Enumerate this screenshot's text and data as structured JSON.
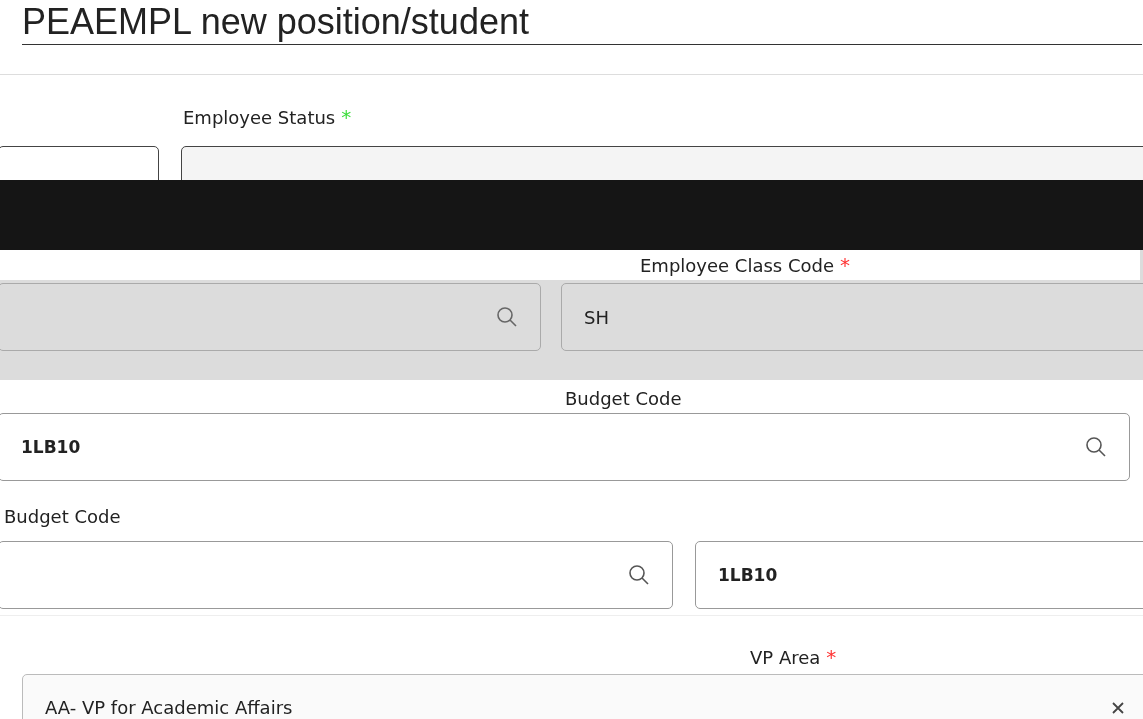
{
  "title": "PEAEMPL new position/student",
  "fields": [
    {
      "label": "Employee Status",
      "marker": "*",
      "color": "#3ddc3d"
    },
    {
      "label": "Employee Class Code",
      "marker": "*",
      "color": "#ff3333",
      "value": "SH"
    },
    {
      "label": "Budget Code",
      "value": "1LB10"
    },
    {
      "label": "Budget Code",
      "value": "1LB10"
    },
    {
      "label": "VP Area",
      "marker": "*",
      "color": "#ff3333",
      "value": "AA- VP for Academic Affairs"
    }
  ]
}
